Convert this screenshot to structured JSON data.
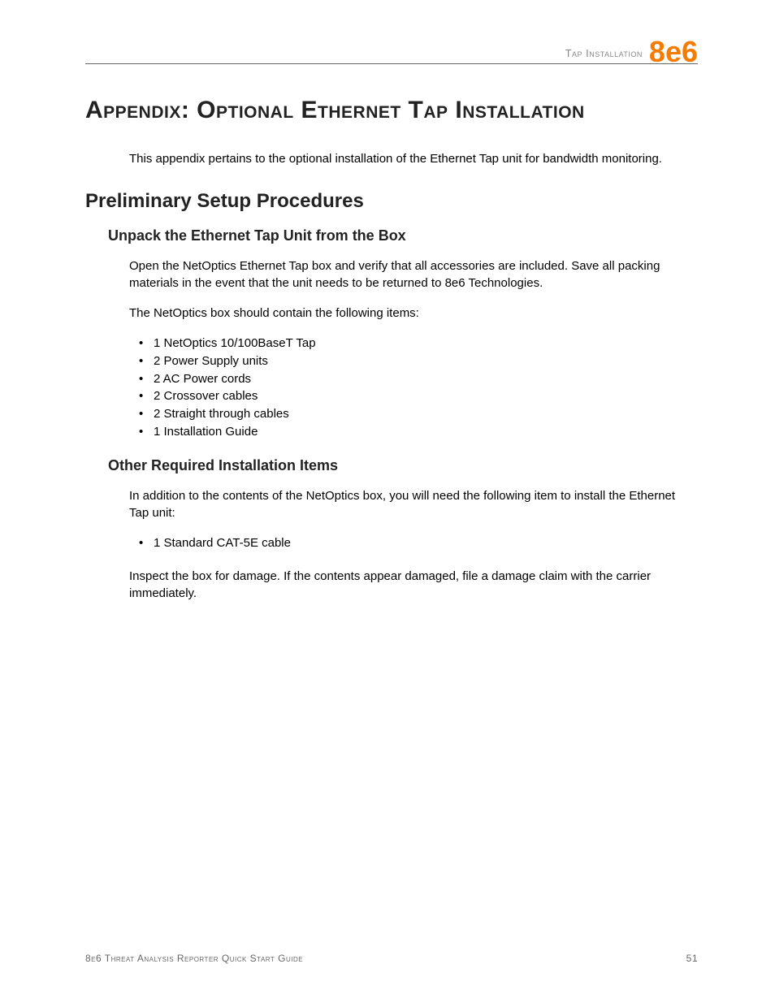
{
  "header": {
    "section_label": "Tap Installation",
    "logo": "8e6"
  },
  "title": "Appendix: Optional Ethernet Tap Installation",
  "intro": "This appendix pertains to the optional installation of the Ethernet Tap unit for bandwidth monitoring.",
  "section1": {
    "heading": "Preliminary Setup Procedures",
    "sub1": {
      "heading": "Unpack the Ethernet Tap Unit from the Box",
      "para1": "Open the NetOptics Ethernet Tap box and verify that all accessories are included. Save all packing materials in the event that the unit needs to be returned to 8e6 Technologies.",
      "para2": "The NetOptics box should contain the following items:",
      "items": [
        "1 NetOptics 10/100BaseT Tap",
        "2 Power Supply units",
        "2 AC Power cords",
        "2 Crossover cables",
        "2 Straight through cables",
        "1 Installation Guide"
      ]
    },
    "sub2": {
      "heading": "Other Required Installation Items",
      "para1": "In addition to the contents of the NetOptics box, you will need the following item to install the Ethernet Tap unit:",
      "items": [
        "1 Standard CAT-5E cable"
      ],
      "para2": "Inspect the box for damage. If the contents appear damaged, file a damage claim with the carrier immediately."
    }
  },
  "footer": {
    "guide_name": "8e6 Threat Analysis Reporter Quick Start Guide",
    "page_number": "51"
  }
}
